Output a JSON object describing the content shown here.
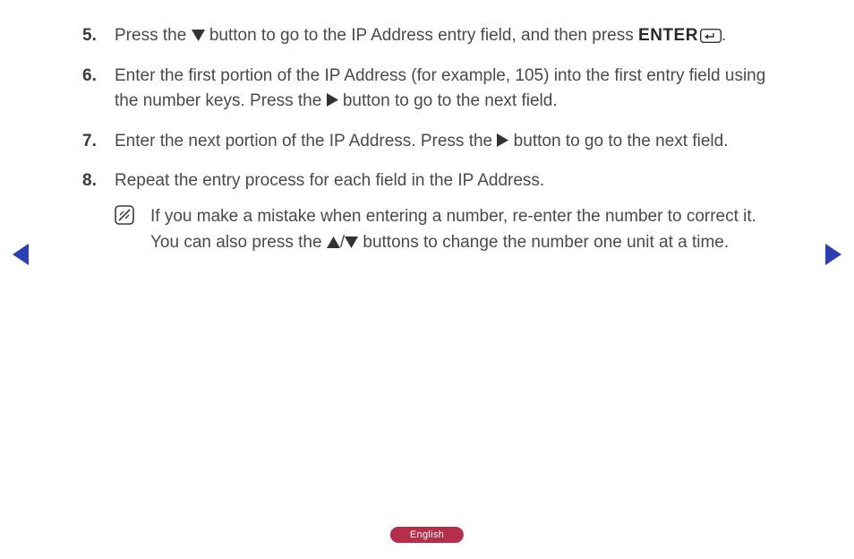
{
  "steps": {
    "s5": {
      "num": "5.",
      "part1": "Press the ",
      "part2": " button to go to the IP Address entry field, and then press ",
      "enter": "ENTER",
      "part3": "."
    },
    "s6": {
      "num": "6.",
      "part1": "Enter the first portion of the IP Address (for example, 105) into the first entry field using the number keys. Press the ",
      "part2": " button to go to the next field."
    },
    "s7": {
      "num": "7.",
      "part1": "Enter the next portion of the IP Address. Press the ",
      "part2": " button to go to the next field."
    },
    "s8": {
      "num": "8.",
      "text": "Repeat the entry process for each field in the IP Address."
    }
  },
  "note": {
    "part1": "If you make a mistake when entering a number, re-enter the number to correct it. You can also press the ",
    "slash": "/",
    "part2": " buttons to change the number one unit at a time."
  },
  "footer": {
    "language": "English"
  }
}
